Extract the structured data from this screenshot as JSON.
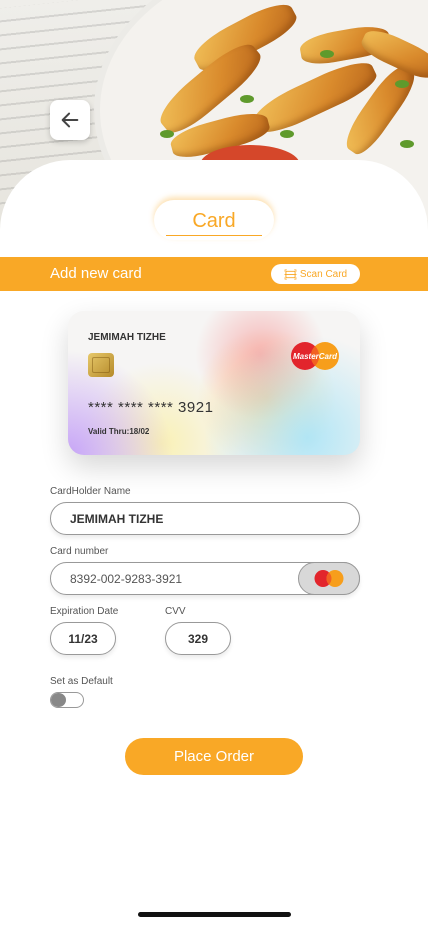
{
  "header": {
    "back_icon": "arrow-left-icon",
    "tab_label": "Card"
  },
  "add_card_bar": {
    "title": "Add new card",
    "scan_button_label": "Scan Card",
    "scan_icon": "scan-card-icon"
  },
  "card_preview": {
    "holder_name": "JEMIMAH TIZHE",
    "masked_number": "**** **** **** 3921",
    "valid_thru": "Valid Thru:18/02",
    "brand_logo_text": "MasterCard"
  },
  "form": {
    "cardholder_label": "CardHolder Name",
    "cardholder_value": "JEMIMAH TIZHE",
    "card_number_label": "Card number",
    "card_number_value": "8392-002-9283-3921",
    "expiration_label": "Expiration Date",
    "expiration_value": "11/23",
    "cvv_label": "CVV",
    "cvv_value": "329",
    "default_label": "Set as Default",
    "default_toggle_on": false
  },
  "place_order_label": "Place Order",
  "colors": {
    "accent": "#f9a826",
    "text": "#333333",
    "border": "#999999"
  }
}
